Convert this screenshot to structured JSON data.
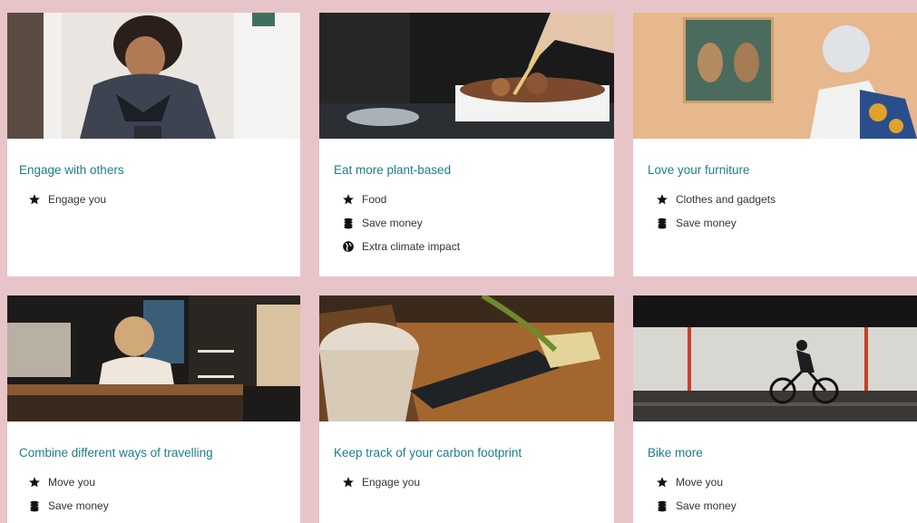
{
  "cards": [
    {
      "title": "Engage with others",
      "tags": [
        {
          "icon": "star-icon",
          "label": "Engage you"
        }
      ]
    },
    {
      "title": "Eat more plant-based",
      "tags": [
        {
          "icon": "star-icon",
          "label": "Food"
        },
        {
          "icon": "coins-icon",
          "label": "Save money"
        },
        {
          "icon": "globe-icon",
          "label": "Extra climate impact"
        }
      ]
    },
    {
      "title": "Love your furniture",
      "tags": [
        {
          "icon": "star-icon",
          "label": "Clothes and gadgets"
        },
        {
          "icon": "coins-icon",
          "label": "Save money"
        }
      ]
    },
    {
      "title": "Combine different ways of travelling",
      "tags": [
        {
          "icon": "star-icon",
          "label": "Move you"
        },
        {
          "icon": "coins-icon",
          "label": "Save money"
        }
      ]
    },
    {
      "title": "Keep track of your carbon footprint",
      "tags": [
        {
          "icon": "star-icon",
          "label": "Engage you"
        }
      ]
    },
    {
      "title": "Bike more",
      "tags": [
        {
          "icon": "star-icon",
          "label": "Move you"
        },
        {
          "icon": "coins-icon",
          "label": "Save money"
        }
      ]
    }
  ],
  "colors": {
    "background": "#e7c4c8",
    "title": "#1c7d8c",
    "text": "#333333"
  }
}
